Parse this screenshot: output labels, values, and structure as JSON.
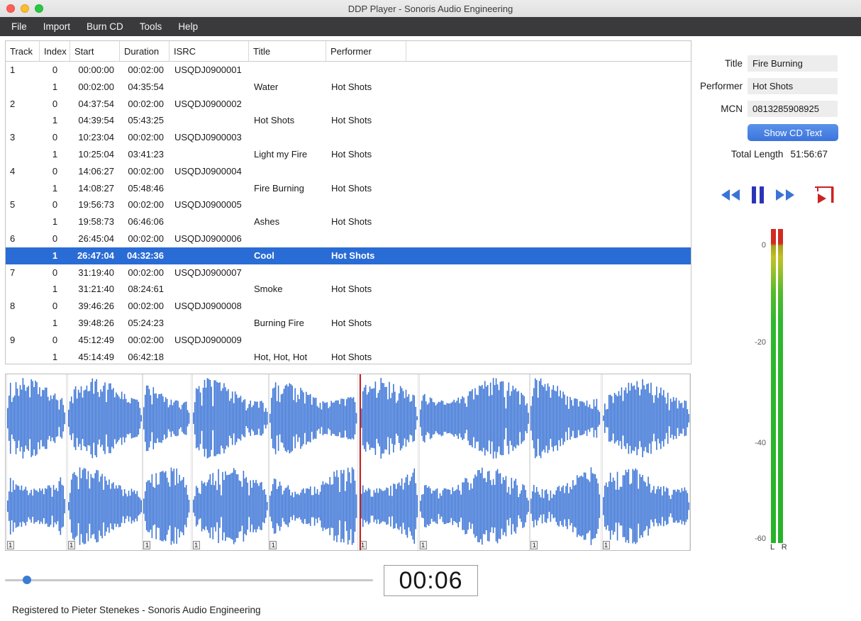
{
  "colors": {
    "accent": "#3a74d6",
    "selection": "#2a6cd5",
    "waveform": "#3b74d6",
    "button_blue": "#3f7be0",
    "transport_red": "#cc2222",
    "meter_red": "#d22a22",
    "meter_green": "#2eb82e"
  },
  "window": {
    "title": "DDP Player - Sonoris Audio Engineering"
  },
  "menu": {
    "items": [
      "File",
      "Import",
      "Burn CD",
      "Tools",
      "Help"
    ]
  },
  "table": {
    "columns": [
      "Track",
      "Index",
      "Start",
      "Duration",
      "ISRC",
      "Title",
      "Performer"
    ],
    "rows": [
      {
        "track": "1",
        "index": "0",
        "start": "00:00:00",
        "duration": "00:02:00",
        "isrc": "USQDJ0900001",
        "title": "",
        "performer": ""
      },
      {
        "track": "",
        "index": "1",
        "start": "00:02:00",
        "duration": "04:35:54",
        "isrc": "",
        "title": "Water",
        "performer": "Hot Shots"
      },
      {
        "track": "2",
        "index": "0",
        "start": "04:37:54",
        "duration": "00:02:00",
        "isrc": "USQDJ0900002",
        "title": "",
        "performer": ""
      },
      {
        "track": "",
        "index": "1",
        "start": "04:39:54",
        "duration": "05:43:25",
        "isrc": "",
        "title": "Hot Shots",
        "performer": "Hot Shots"
      },
      {
        "track": "3",
        "index": "0",
        "start": "10:23:04",
        "duration": "00:02:00",
        "isrc": "USQDJ0900003",
        "title": "",
        "performer": ""
      },
      {
        "track": "",
        "index": "1",
        "start": "10:25:04",
        "duration": "03:41:23",
        "isrc": "",
        "title": "Light my Fire",
        "performer": "Hot Shots"
      },
      {
        "track": "4",
        "index": "0",
        "start": "14:06:27",
        "duration": "00:02:00",
        "isrc": "USQDJ0900004",
        "title": "",
        "performer": ""
      },
      {
        "track": "",
        "index": "1",
        "start": "14:08:27",
        "duration": "05:48:46",
        "isrc": "",
        "title": "Fire Burning",
        "performer": "Hot Shots"
      },
      {
        "track": "5",
        "index": "0",
        "start": "19:56:73",
        "duration": "00:02:00",
        "isrc": "USQDJ0900005",
        "title": "",
        "performer": ""
      },
      {
        "track": "",
        "index": "1",
        "start": "19:58:73",
        "duration": "06:46:06",
        "isrc": "",
        "title": "Ashes",
        "performer": "Hot Shots"
      },
      {
        "track": "6",
        "index": "0",
        "start": "26:45:04",
        "duration": "00:02:00",
        "isrc": "USQDJ0900006",
        "title": "",
        "performer": ""
      },
      {
        "track": "",
        "index": "1",
        "start": "26:47:04",
        "duration": "04:32:36",
        "isrc": "",
        "title": "Cool",
        "performer": "Hot Shots",
        "selected": true
      },
      {
        "track": "7",
        "index": "0",
        "start": "31:19:40",
        "duration": "00:02:00",
        "isrc": "USQDJ0900007",
        "title": "",
        "performer": ""
      },
      {
        "track": "",
        "index": "1",
        "start": "31:21:40",
        "duration": "08:24:61",
        "isrc": "",
        "title": "Smoke",
        "performer": "Hot Shots"
      },
      {
        "track": "8",
        "index": "0",
        "start": "39:46:26",
        "duration": "00:02:00",
        "isrc": "USQDJ0900008",
        "title": "",
        "performer": ""
      },
      {
        "track": "",
        "index": "1",
        "start": "39:48:26",
        "duration": "05:24:23",
        "isrc": "",
        "title": "Burning Fire",
        "performer": "Hot Shots"
      },
      {
        "track": "9",
        "index": "0",
        "start": "45:12:49",
        "duration": "00:02:00",
        "isrc": "USQDJ0900009",
        "title": "",
        "performer": ""
      },
      {
        "track": "",
        "index": "1",
        "start": "45:14:49",
        "duration": "06:42:18",
        "isrc": "",
        "title": "Hot, Hot, Hot",
        "performer": "Hot Shots"
      }
    ]
  },
  "sidebar": {
    "title_label": "Title",
    "title_value": "Fire Burning",
    "performer_label": "Performer",
    "performer_value": "Hot Shots",
    "mcn_label": "MCN",
    "mcn_value": "0813285908925",
    "cdtext_button": "Show CD Text",
    "total_length_label": "Total Length",
    "total_length_value": "51:56:67"
  },
  "meter": {
    "scale": [
      {
        "db": "0",
        "pos": 0.054
      },
      {
        "db": "-20",
        "pos": 0.364
      },
      {
        "db": "-40",
        "pos": 0.683
      },
      {
        "db": "-60",
        "pos": 0.989
      }
    ],
    "channel_labels": "L R"
  },
  "waveform": {
    "marker_label": "1",
    "playhead": 0.5175,
    "segments": [
      {
        "start": 0.0006,
        "end": 0.0891
      },
      {
        "start": 0.0898,
        "end": 0.2001
      },
      {
        "start": 0.2005,
        "end": 0.2716
      },
      {
        "start": 0.2722,
        "end": 0.384
      },
      {
        "start": 0.3847,
        "end": 0.5149
      },
      {
        "start": 0.5156,
        "end": 0.603
      },
      {
        "start": 0.6037,
        "end": 0.7656
      },
      {
        "start": 0.7661,
        "end": 0.8702
      },
      {
        "start": 0.871,
        "end": 1.0
      }
    ]
  },
  "player": {
    "time": "00:06",
    "slider_pos": 0.048
  },
  "status": {
    "registration": "Registered to Pieter Stenekes - Sonoris Audio Engineering"
  }
}
